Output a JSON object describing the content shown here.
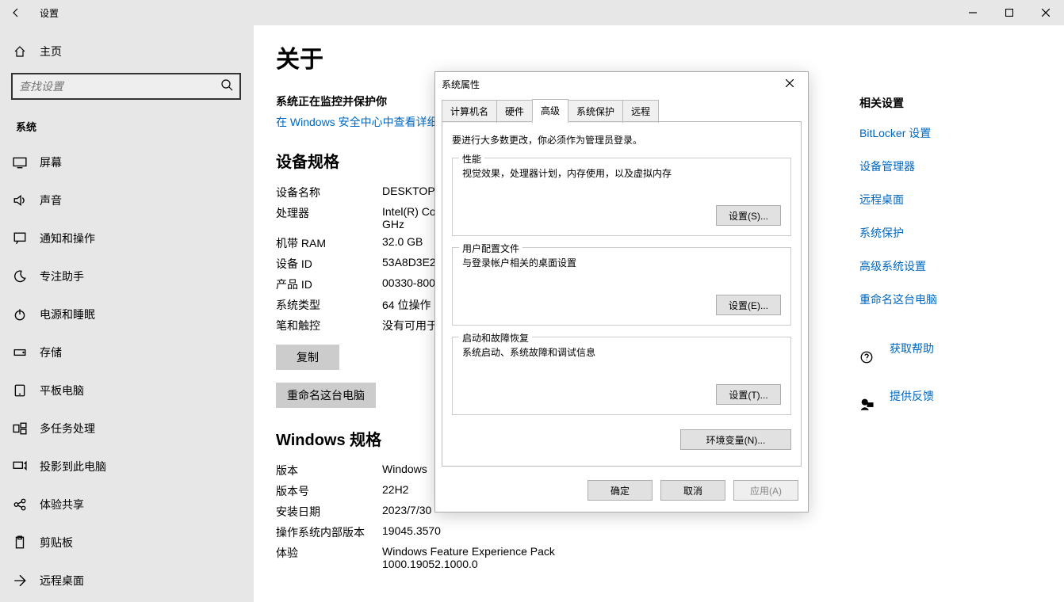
{
  "titlebar": {
    "title": "设置"
  },
  "sidebar": {
    "home": "主页",
    "search_placeholder": "查找设置",
    "section": "系统",
    "items": [
      {
        "label": "屏幕"
      },
      {
        "label": "声音"
      },
      {
        "label": "通知和操作"
      },
      {
        "label": "专注助手"
      },
      {
        "label": "电源和睡眠"
      },
      {
        "label": "存储"
      },
      {
        "label": "平板电脑"
      },
      {
        "label": "多任务处理"
      },
      {
        "label": "投影到此电脑"
      },
      {
        "label": "体验共享"
      },
      {
        "label": "剪贴板"
      },
      {
        "label": "远程桌面"
      }
    ]
  },
  "main": {
    "heading": "关于",
    "protect": "系统正在监控并保护你",
    "security_link": "在 Windows 安全中心中查看详细",
    "device_spec_heading": "设备规格",
    "device_rows": [
      {
        "k": "设备名称",
        "v": "DESKTOP-"
      },
      {
        "k": "处理器",
        "v": "Intel(R) Co\nGHz"
      },
      {
        "k": "机带 RAM",
        "v": "32.0 GB"
      },
      {
        "k": "设备 ID",
        "v": "53A8D3E2"
      },
      {
        "k": "产品 ID",
        "v": "00330-800"
      },
      {
        "k": "系统类型",
        "v": "64 位操作"
      },
      {
        "k": "笔和触控",
        "v": "没有可用于"
      }
    ],
    "copy_btn": "复制",
    "rename_btn": "重命名这台电脑",
    "win_spec_heading": "Windows 规格",
    "win_rows": [
      {
        "k": "版本",
        "v": "Windows "
      },
      {
        "k": "版本号",
        "v": "22H2"
      },
      {
        "k": "安装日期",
        "v": "2023/7/30"
      },
      {
        "k": "操作系统内部版本",
        "v": "19045.3570"
      },
      {
        "k": "体验",
        "v": "Windows Feature Experience Pack 1000.19052.1000.0"
      }
    ]
  },
  "right": {
    "header": "相关设置",
    "links": [
      "BitLocker 设置",
      "设备管理器",
      "远程桌面",
      "系统保护",
      "高级系统设置",
      "重命名这台电脑"
    ],
    "help": "获取帮助",
    "feedback": "提供反馈"
  },
  "dialog": {
    "title": "系统属性",
    "tabs": [
      "计算机名",
      "硬件",
      "高级",
      "系统保护",
      "远程"
    ],
    "active_tab": "高级",
    "note": "要进行大多数更改，你必须作为管理员登录。",
    "perf": {
      "legend": "性能",
      "desc": "视觉效果，处理器计划，内存使用，以及虚拟内存",
      "btn": "设置(S)..."
    },
    "profile": {
      "legend": "用户配置文件",
      "desc": "与登录帐户相关的桌面设置",
      "btn": "设置(E)..."
    },
    "startup": {
      "legend": "启动和故障恢复",
      "desc": "系统启动、系统故障和调试信息",
      "btn": "设置(T)..."
    },
    "env_btn": "环境变量(N)...",
    "ok": "确定",
    "cancel": "取消",
    "apply": "应用(A)"
  }
}
